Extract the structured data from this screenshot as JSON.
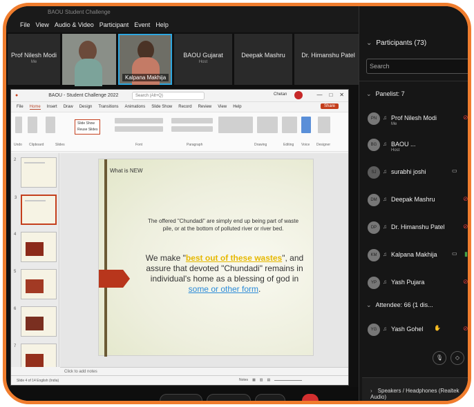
{
  "window": {
    "top_title": "BAOU Student Challenge",
    "menus": [
      "File",
      "View",
      "Audio & Video",
      "Participant",
      "Event",
      "Help"
    ]
  },
  "video_strip": [
    {
      "name": "Prof Nilesh Modi",
      "sub": "Me",
      "video": false
    },
    {
      "name": "",
      "sub": "",
      "video": true
    },
    {
      "name": "Kalpana Makhija",
      "sub": "",
      "video": true,
      "active": true
    },
    {
      "name": "BAOU Gujarat",
      "sub": "Host",
      "video": false
    },
    {
      "name": "Deepak Mashru",
      "sub": "",
      "video": false
    },
    {
      "name": "Dr. Himanshu Patel",
      "sub": "",
      "video": false
    }
  ],
  "ppt": {
    "title": "BAOU - Student Challenge 2022",
    "search_placeholder": "Search (Alt+Q)",
    "user": "Chetan",
    "window_buttons": [
      "—",
      "□",
      "✕"
    ],
    "tabs": [
      "File",
      "Home",
      "Insert",
      "Draw",
      "Design",
      "Transitions",
      "Animations",
      "Slide Show",
      "Record",
      "Review",
      "View",
      "Help"
    ],
    "active_tab": "Home",
    "share": "Share",
    "ribbon_groups": [
      "Undo",
      "Clipboard",
      "Slides",
      "Font",
      "Paragraph",
      "Drawing",
      "Editing",
      "Voice",
      "Designer"
    ],
    "slide_menu": [
      "Slide Show",
      "Reuse Slides"
    ],
    "thumb_numbers": [
      "2",
      "3",
      "4",
      "5",
      "6",
      "7"
    ],
    "slide": {
      "heading": "What is NEW",
      "p1": "The offered \"Chundadi\" are simply end up being part of waste pile, or at the bottom of polluted river or river bed.",
      "p2_pre": "We make \"",
      "p2_highlight": "best out of these wastes",
      "p2_mid": "\", and assure that devoted \"Chundadi\" remains in individual's home as a blessing of god in ",
      "p2_link": "some or other form",
      "p2_post": "."
    },
    "notes": "Click to add notes",
    "status_left": "Slide 4 of 14    English (India)",
    "status_right_label": "Notes"
  },
  "participants": {
    "header": "Participants (73)",
    "search_placeholder": "Search",
    "panelist_header": "Panelist: 7",
    "panelists": [
      {
        "initials": "PN",
        "name": "Prof Nilesh Modi",
        "role": "Me",
        "mic": "muted"
      },
      {
        "initials": "BG",
        "name": "BAOU ...",
        "role": "Host",
        "mic": "none"
      },
      {
        "initials": "SJ",
        "name": "surabhi joshi",
        "role": "",
        "mic": "cam"
      },
      {
        "initials": "DM",
        "name": "Deepak Mashru",
        "role": "",
        "mic": "muted"
      },
      {
        "initials": "DP",
        "name": "Dr. Himanshu Patel",
        "role": "",
        "mic": "muted"
      },
      {
        "initials": "KM",
        "name": "Kalpana Makhija",
        "role": "",
        "mic": "active"
      },
      {
        "initials": "YP",
        "name": "Yash Pujara",
        "role": "",
        "mic": "muted"
      }
    ],
    "attendee_header": "Attendee: 66 (1 dis...",
    "attendees": [
      {
        "initials": "YG",
        "name": "Yash Gohel",
        "role": "",
        "mic": "muted"
      }
    ],
    "audio_device": "Speakers / Headphones (Realtek Audio)"
  },
  "colors": {
    "frame": "#f07d2e",
    "ppt_accent": "#c43e1c",
    "highlight": "#e6b800",
    "link": "#2a8ad8"
  }
}
